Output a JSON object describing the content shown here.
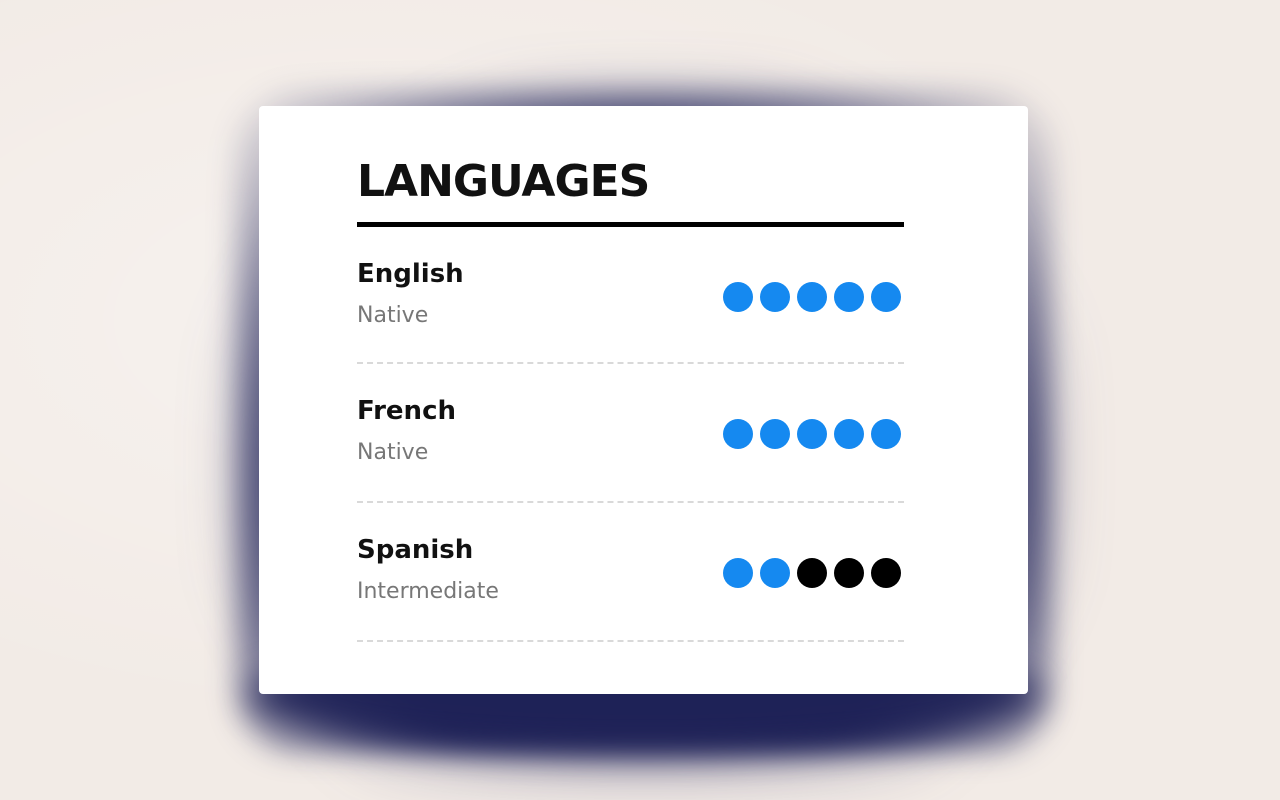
{
  "section": {
    "title": "LANGUAGES"
  },
  "colors": {
    "filled_dot": "#1589f0",
    "empty_dot": "#000000",
    "background": "#f2ebe6",
    "shadow": "#1e2157"
  },
  "languages": [
    {
      "name": "English",
      "level": "Native",
      "rating": 5,
      "max_rating": 5
    },
    {
      "name": "French",
      "level": "Native",
      "rating": 5,
      "max_rating": 5
    },
    {
      "name": "Spanish",
      "level": "Intermediate",
      "rating": 2,
      "max_rating": 5
    }
  ]
}
